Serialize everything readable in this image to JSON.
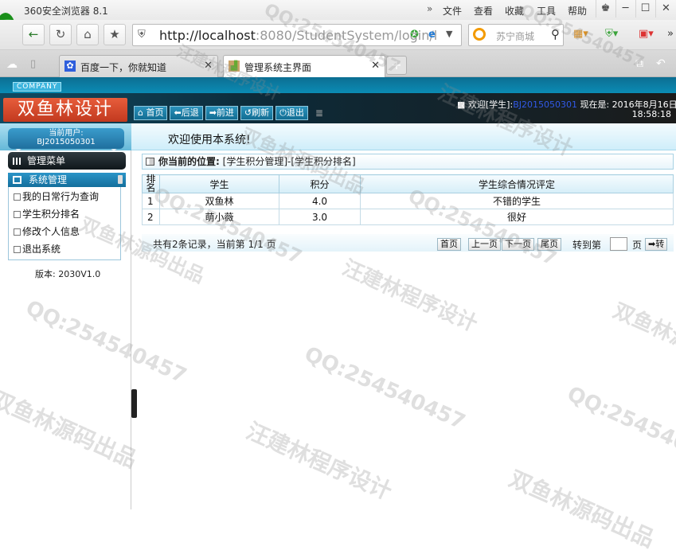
{
  "browser": {
    "app_title": "360安全浏览器 8.1",
    "menu": [
      "文件",
      "查看",
      "收藏",
      "工具",
      "帮助"
    ],
    "menu_arrows": "»",
    "url_host": "http://localhost",
    "url_rest": ":8080/StudentSystem/login/l",
    "search_placeholder": "苏宁商城",
    "tabs": [
      {
        "label": "百度一下，你就知道",
        "active": false
      },
      {
        "label": "管理系统主界面",
        "active": true
      }
    ]
  },
  "header": {
    "company_badge": "COMPANY",
    "brand": "双鱼林设计",
    "nav_buttons": [
      "首页",
      "后退",
      "前进",
      "刷新",
      "退出"
    ],
    "welcome_text": "欢迎[学生]:",
    "user_id_highlight": "BJ2015050301",
    "now_text": "现在是: 2016年8月16日",
    "time_text": "18:58:18"
  },
  "userbar": {
    "current_user_label": "当前用户:",
    "user_id": "BJ2015050301",
    "welcome_message": "欢迎使用本系统!"
  },
  "sidebar": {
    "menu_title": "管理菜单",
    "section_title": "系统管理",
    "items": [
      "我的日常行为查询",
      "学生积分排名",
      "修改个人信息",
      "退出系统"
    ],
    "version": "版本: 2030V1.0"
  },
  "content": {
    "location_label": "你当前的位置:",
    "location_path": "[学生积分管理]-[学生积分排名]",
    "table": {
      "headers": [
        "排名",
        "学生",
        "积分",
        "学生综合情况评定"
      ],
      "rows": [
        {
          "rank": "1",
          "student": "双鱼林",
          "score": "4.0",
          "evaluation": "不错的学生"
        },
        {
          "rank": "2",
          "student": "萌小薇",
          "score": "3.0",
          "evaluation": "很好"
        }
      ]
    },
    "pager": {
      "info": "共有2条记录，当前第 1/1 页",
      "first": "首页",
      "prev": "上一页",
      "next": "下一页",
      "last": "尾页",
      "goto_label": "转到第",
      "page_label": "页",
      "go_button": "➡转"
    }
  },
  "watermarks": [
    "QQ:254540457",
    "汪建林程序设计",
    "双鱼林源码出品"
  ]
}
